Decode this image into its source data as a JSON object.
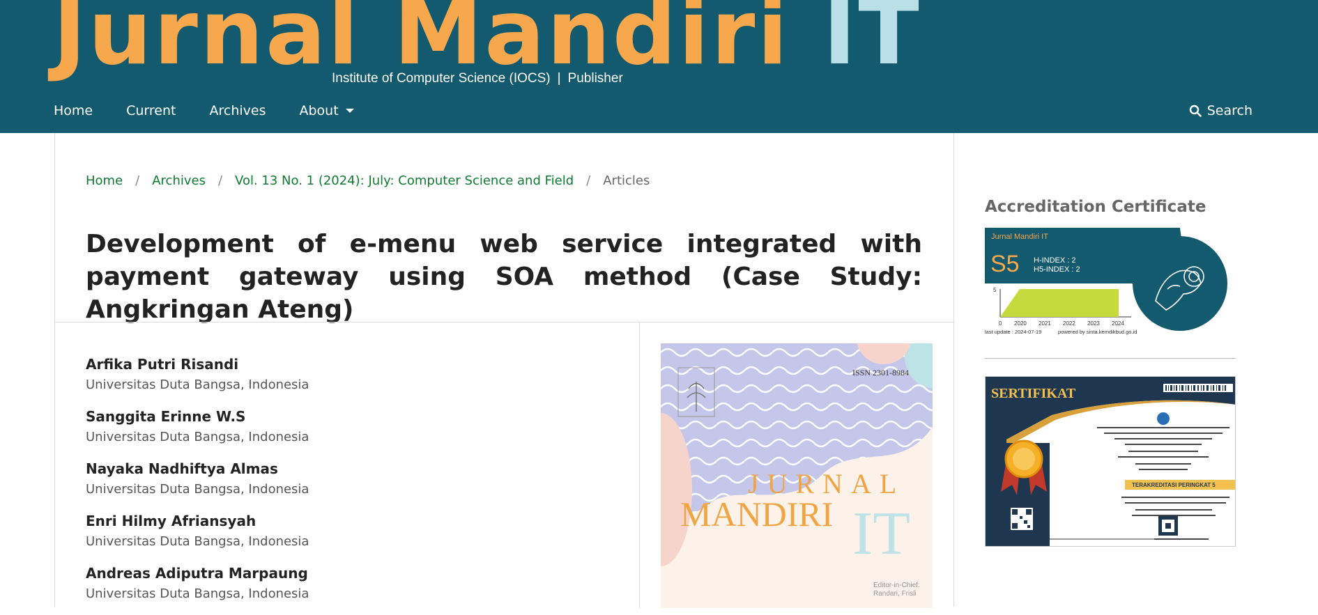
{
  "header": {
    "logo_part1": "Jurnal Mandiri",
    "logo_part2": "IT",
    "subtitle_left": "Institute of Computer Science (IOCS)",
    "subtitle_sep": "|",
    "subtitle_right": "Publisher",
    "nav": [
      "Home",
      "Current",
      "Archives",
      "About"
    ],
    "search_label": "Search"
  },
  "breadcrumb": {
    "items": [
      "Home",
      "Archives",
      "Vol. 13 No. 1 (2024): July: Computer Science and Field"
    ],
    "separator": "/",
    "current": "Articles"
  },
  "article": {
    "title": "Development of e-menu web service integrated with payment gateway using SOA method (Case Study: Angkringan Ateng)",
    "authors": [
      {
        "name": "Arfika Putri Risandi",
        "affiliation": "Universitas Duta Bangsa, Indonesia"
      },
      {
        "name": "Sanggita Erinne W.S",
        "affiliation": "Universitas Duta Bangsa, Indonesia"
      },
      {
        "name": "Nayaka Nadhiftya Almas",
        "affiliation": "Universitas Duta Bangsa, Indonesia"
      },
      {
        "name": "Enri Hilmy Afriansyah",
        "affiliation": "Universitas Duta Bangsa, Indonesia"
      },
      {
        "name": "Andreas Adiputra Marpaung",
        "affiliation": "Universitas Duta Bangsa, Indonesia"
      }
    ]
  },
  "cover": {
    "issn": "ISSN 2301-8984",
    "word1": "JURNAL",
    "word2": "MANDIRI",
    "word3": "IT",
    "editor_line1": "Editor-in-Chief:",
    "editor_line2": "Randari, Frisli"
  },
  "sidebar": {
    "title": "Accreditation Certificate",
    "sinta": {
      "journal": "Jurnal Mandiri IT",
      "grade": "S5",
      "h_index": "H-INDEX : 2",
      "h5_index": "H5-INDEX : 2",
      "y_tick": "5",
      "x_ticks": [
        "0",
        "2020",
        "2021",
        "2022",
        "2023",
        "2024"
      ],
      "last_update": "last update : 2024-07-19",
      "powered": "powered by sinta.kemdikbud.go.id"
    },
    "sertifikat": {
      "title": "SERTIFIKAT",
      "badge": "TERAKREDITASI PERINGKAT 5"
    }
  },
  "colors": {
    "header_bg": "#135a6e",
    "logo_orange": "#f8a84c",
    "logo_light": "#b9e0e6",
    "link_green": "#0e7a2f"
  }
}
